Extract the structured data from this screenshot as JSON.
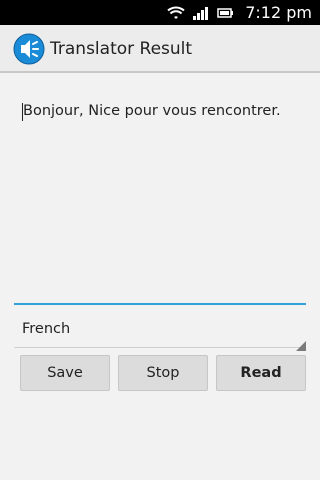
{
  "status_bar": {
    "time": "7:12 pm"
  },
  "action_bar": {
    "title": "Translator Result"
  },
  "result": {
    "text": "Bonjour, Nice pour vous rencontrer."
  },
  "language_spinner": {
    "selected": "French"
  },
  "buttons": {
    "save": "Save",
    "stop": "Stop",
    "read": "Read"
  },
  "colors": {
    "accent": "#33a0d6",
    "status_bar_bg": "#000000"
  }
}
